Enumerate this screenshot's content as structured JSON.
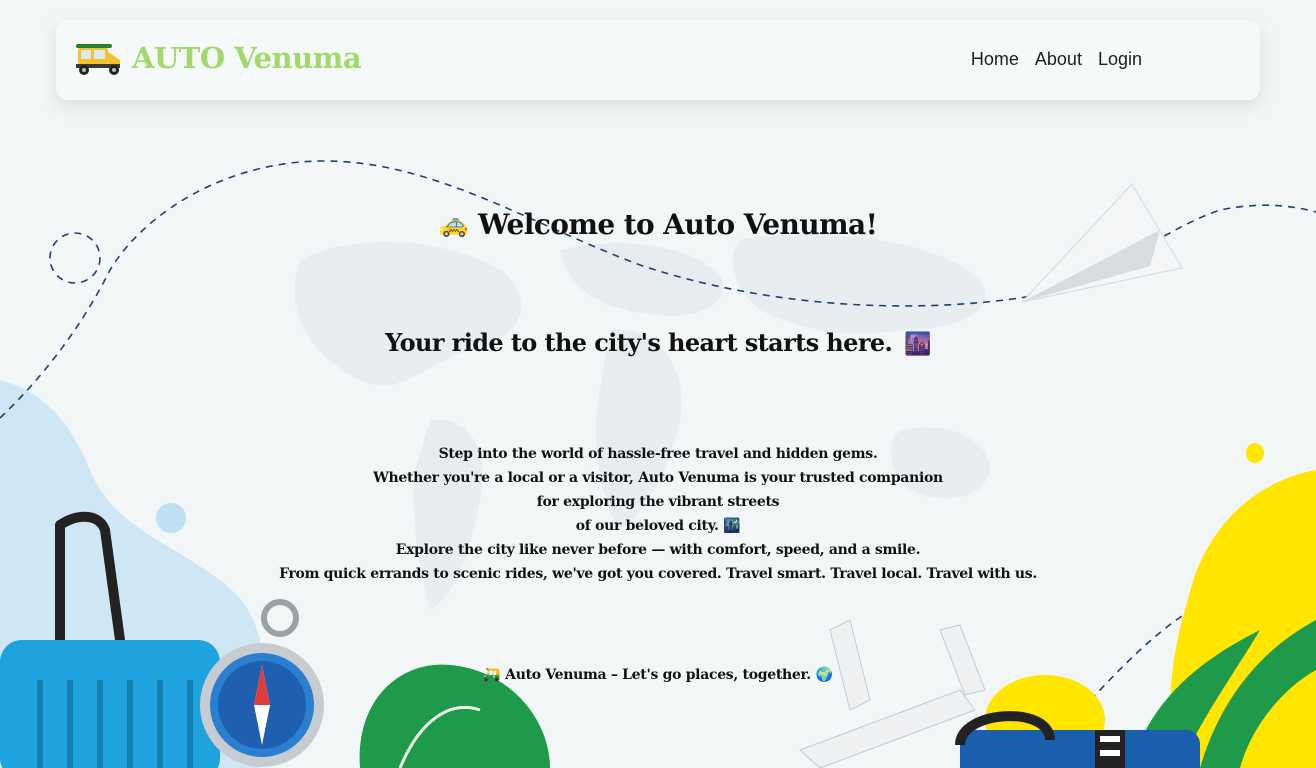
{
  "brand": {
    "name": "AUTO Venuma",
    "logo_icon": "auto-rickshaw-icon"
  },
  "nav": {
    "items": [
      {
        "label": "Home"
      },
      {
        "label": "About"
      },
      {
        "label": "Login"
      }
    ]
  },
  "hero": {
    "welcome_emoji": "🚕",
    "welcome_text": "Welcome to Auto Venuma!",
    "tagline_text": "Your ride to the city's heart starts here.",
    "tagline_emoji": "🌆",
    "intro_lines": [
      "Step into the world of hassle-free travel and hidden gems.",
      "Whether you're a local or a visitor, Auto Venuma is your trusted companion",
      "for exploring the vibrant streets",
      "of our beloved city. 🌃",
      "Explore the city like never before — with comfort, speed, and a smile.",
      "From quick errands to scenic rides, we've got you covered. Travel smart. Travel local. Travel with us."
    ],
    "footer_emoji": "🛺",
    "footer_text": "Auto Venuma – Let's go places, together.",
    "footer_emoji_end": "🌍"
  },
  "colors": {
    "brand_green": "#a3d96b",
    "text_dark": "#111111",
    "accent_yellow": "#ffe500",
    "accent_blue": "#2fa7e0"
  }
}
